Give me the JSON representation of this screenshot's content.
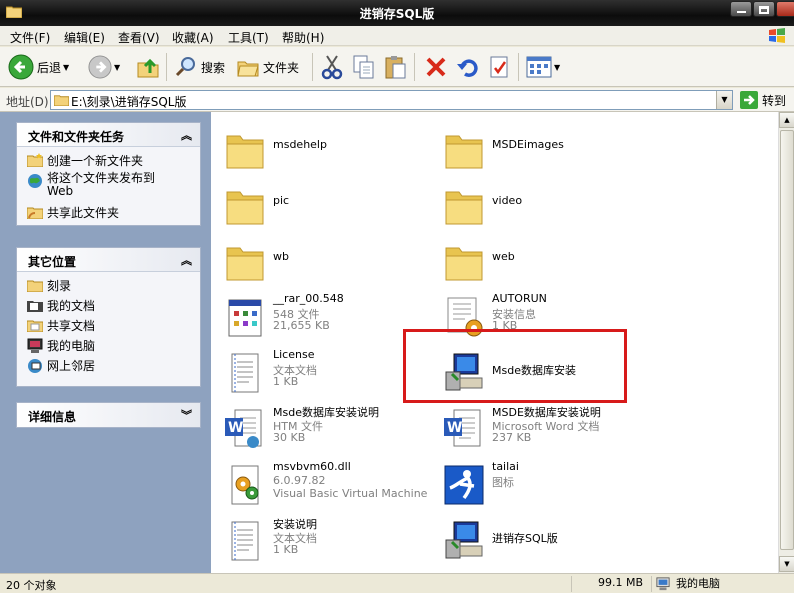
{
  "window": {
    "title": "进销存SQL版"
  },
  "menu": [
    "文件(F)",
    "编辑(E)",
    "查看(V)",
    "收藏(A)",
    "工具(T)",
    "帮助(H)"
  ],
  "toolbar": {
    "back": "后退",
    "search": "搜索",
    "folders": "文件夹"
  },
  "address": {
    "label": "地址(D)",
    "path": "E:\\刻录\\进销存SQL版",
    "go": "转到"
  },
  "tasks": {
    "title": "文件和文件夹任务",
    "items": [
      "创建一个新文件夹",
      "将这个文件夹发布到",
      "Web",
      "共享此文件夹"
    ]
  },
  "places": {
    "title": "其它位置",
    "items": [
      "刻录",
      "我的文档",
      "共享文档",
      "我的电脑",
      "网上邻居"
    ]
  },
  "details": {
    "title": "详细信息"
  },
  "files": [
    {
      "name": "msdehelp",
      "l1": "",
      "l2": ""
    },
    {
      "name": "MSDEimages",
      "l1": "",
      "l2": ""
    },
    {
      "name": "pic",
      "l1": "",
      "l2": ""
    },
    {
      "name": "video",
      "l1": "",
      "l2": ""
    },
    {
      "name": "wb",
      "l1": "",
      "l2": ""
    },
    {
      "name": "web",
      "l1": "",
      "l2": ""
    },
    {
      "name": "__rar_00.548",
      "l1": "548 文件",
      "l2": "21,655 KB"
    },
    {
      "name": "AUTORUN",
      "l1": "安装信息",
      "l2": "1 KB"
    },
    {
      "name": "License",
      "l1": "文本文档",
      "l2": "1 KB"
    },
    {
      "name": "Msde数据库安装",
      "l1": "",
      "l2": ""
    },
    {
      "name": "Msde数据库安装说明",
      "l1": "HTM 文件",
      "l2": "30 KB"
    },
    {
      "name": "MSDE数据库安装说明",
      "l1": "Microsoft Word 文档",
      "l2": "237 KB"
    },
    {
      "name": "msvbvm60.dll",
      "l1": "6.0.97.82",
      "l2": "Visual Basic Virtual Machine"
    },
    {
      "name": "tailai",
      "l1": "图标",
      "l2": ""
    },
    {
      "name": "安装说明",
      "l1": "文本文档",
      "l2": "1 KB"
    },
    {
      "name": "进销存SQL版",
      "l1": "",
      "l2": ""
    }
  ],
  "status": {
    "count": "20 个对象",
    "size": "99.1 MB",
    "location": "我的电脑"
  }
}
